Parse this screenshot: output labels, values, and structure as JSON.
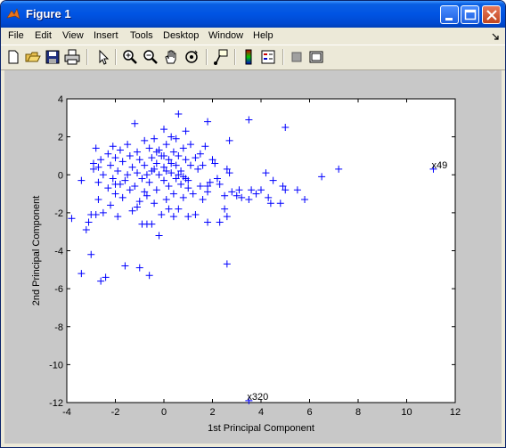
{
  "window": {
    "title": "Figure 1"
  },
  "menu": [
    "File",
    "Edit",
    "View",
    "Insert",
    "Tools",
    "Desktop",
    "Window",
    "Help"
  ],
  "toolbar_icons": [
    "new-icon",
    "open-icon",
    "save-icon",
    "print-icon",
    "pointer-icon",
    "zoom-in-icon",
    "zoom-out-icon",
    "pan-icon",
    "rotate-icon",
    "data-cursor-icon",
    "colorbar-icon",
    "legend-icon",
    "hide-tools-icon",
    "show-tools-icon"
  ],
  "colors": {
    "marker": "#0000ff",
    "figure_bg": "#c8c8c8",
    "titlebar": "#0054e3"
  },
  "chart_data": {
    "type": "scatter",
    "title": "",
    "xlabel": "1st Principal Component",
    "ylabel": "2nd Principal Component",
    "xlim": [
      -4,
      12
    ],
    "ylim": [
      -12,
      4
    ],
    "xticks": [
      -4,
      -2,
      0,
      2,
      4,
      6,
      8,
      10,
      12
    ],
    "yticks": [
      -12,
      -10,
      -8,
      -6,
      -4,
      -2,
      0,
      2,
      4
    ],
    "grid": false,
    "marker": "+",
    "annotations": [
      {
        "text": "x49",
        "x": 11.1,
        "y": 0.3
      },
      {
        "text": "x320",
        "x": 3.5,
        "y": -11.9
      }
    ],
    "points": [
      [
        11.1,
        0.3
      ],
      [
        3.5,
        -11.9
      ],
      [
        7.2,
        0.3
      ],
      [
        6.5,
        -0.1
      ],
      [
        5.8,
        -1.3
      ],
      [
        5.5,
        -0.8
      ],
      [
        5.0,
        -0.8
      ],
      [
        5.0,
        2.5
      ],
      [
        4.9,
        -0.6
      ],
      [
        4.8,
        -1.5
      ],
      [
        4.5,
        -0.3
      ],
      [
        4.4,
        -1.5
      ],
      [
        4.3,
        -1.2
      ],
      [
        4.2,
        0.1
      ],
      [
        4.0,
        -0.8
      ],
      [
        3.8,
        -1.0
      ],
      [
        3.6,
        -0.8
      ],
      [
        3.5,
        -1.3
      ],
      [
        3.5,
        2.9
      ],
      [
        3.2,
        -1.2
      ],
      [
        3.0,
        -1.1
      ],
      [
        2.8,
        -0.9
      ],
      [
        3.1,
        -0.8
      ],
      [
        2.6,
        0.3
      ],
      [
        2.7,
        0.1
      ],
      [
        2.6,
        -4.7
      ],
      [
        2.3,
        -2.5
      ],
      [
        2.6,
        -2.2
      ],
      [
        2.5,
        -1.1
      ],
      [
        2.5,
        -1.8
      ],
      [
        2.7,
        1.8
      ],
      [
        2.3,
        -0.5
      ],
      [
        2.0,
        0.8
      ],
      [
        2.1,
        0.6
      ],
      [
        2.2,
        -0.2
      ],
      [
        1.9,
        -0.4
      ],
      [
        1.8,
        -0.6
      ],
      [
        1.8,
        2.8
      ],
      [
        1.8,
        -2.5
      ],
      [
        1.8,
        -0.9
      ],
      [
        1.6,
        -1.3
      ],
      [
        1.7,
        1.5
      ],
      [
        1.6,
        0.5
      ],
      [
        1.5,
        1.1
      ],
      [
        1.5,
        -0.6
      ],
      [
        1.4,
        0.3
      ],
      [
        1.2,
        -1.0
      ],
      [
        1.3,
        -2.1
      ],
      [
        1.3,
        0.9
      ],
      [
        1.1,
        0.5
      ],
      [
        1.1,
        1.6
      ],
      [
        1.0,
        -0.3
      ],
      [
        1.0,
        -0.7
      ],
      [
        0.9,
        0.8
      ],
      [
        0.9,
        2.3
      ],
      [
        0.8,
        -1.2
      ],
      [
        0.8,
        1.4
      ],
      [
        0.7,
        0.2
      ],
      [
        0.7,
        -0.5
      ],
      [
        0.6,
        3.2
      ],
      [
        0.6,
        1.0
      ],
      [
        0.6,
        -1.8
      ],
      [
        0.5,
        0.5
      ],
      [
        0.5,
        -0.2
      ],
      [
        0.4,
        1.2
      ],
      [
        0.4,
        -1.0
      ],
      [
        0.3,
        2.0
      ],
      [
        0.3,
        0.1
      ],
      [
        0.2,
        -0.6
      ],
      [
        0.2,
        0.8
      ],
      [
        0.1,
        1.6
      ],
      [
        0.1,
        -1.3
      ],
      [
        0.0,
        0.4
      ],
      [
        0.0,
        2.4
      ],
      [
        0.0,
        -0.3
      ],
      [
        -0.1,
        1.0
      ],
      [
        -0.1,
        -2.1
      ],
      [
        -0.2,
        0.0
      ],
      [
        -0.2,
        1.3
      ],
      [
        -0.3,
        -0.8
      ],
      [
        -0.3,
        0.6
      ],
      [
        -0.4,
        1.9
      ],
      [
        -0.4,
        -1.5
      ],
      [
        -0.5,
        0.2
      ],
      [
        -0.5,
        0.9
      ],
      [
        -0.6,
        -0.4
      ],
      [
        -0.6,
        1.4
      ],
      [
        -0.7,
        0.0
      ],
      [
        -0.7,
        -1.1
      ],
      [
        -0.8,
        0.5
      ],
      [
        -0.8,
        1.8
      ],
      [
        -0.9,
        -0.2
      ],
      [
        -0.9,
        -2.6
      ],
      [
        -1.0,
        0.8
      ],
      [
        -1.0,
        -1.4
      ],
      [
        -1.1,
        0.1
      ],
      [
        -1.1,
        1.2
      ],
      [
        -1.2,
        -0.6
      ],
      [
        -1.2,
        2.7
      ],
      [
        -1.3,
        0.4
      ],
      [
        -1.3,
        -1.9
      ],
      [
        -1.4,
        1.0
      ],
      [
        -1.4,
        -0.8
      ],
      [
        -1.5,
        0.0
      ],
      [
        -1.5,
        1.6
      ],
      [
        -1.6,
        -0.3
      ],
      [
        -1.6,
        -4.8
      ],
      [
        -1.7,
        0.7
      ],
      [
        -1.7,
        -1.2
      ],
      [
        -1.8,
        1.3
      ],
      [
        -1.8,
        -0.5
      ],
      [
        -1.9,
        0.2
      ],
      [
        -1.9,
        -2.2
      ],
      [
        -2.0,
        0.9
      ],
      [
        -2.0,
        -1.0
      ],
      [
        -2.1,
        -0.2
      ],
      [
        -2.1,
        1.5
      ],
      [
        -2.2,
        0.5
      ],
      [
        -2.2,
        -1.6
      ],
      [
        -2.3,
        -0.7
      ],
      [
        -2.3,
        1.1
      ],
      [
        -2.4,
        -5.4
      ],
      [
        -2.5,
        0.0
      ],
      [
        -2.5,
        -2.0
      ],
      [
        -2.6,
        -5.6
      ],
      [
        -2.6,
        0.8
      ],
      [
        -2.7,
        -0.4
      ],
      [
        -2.7,
        -1.3
      ],
      [
        -2.8,
        1.4
      ],
      [
        -2.9,
        0.3
      ],
      [
        -3.0,
        -2.1
      ],
      [
        -3.0,
        -4.2
      ],
      [
        -3.1,
        -2.5
      ],
      [
        -3.2,
        -2.9
      ],
      [
        -3.4,
        -0.3
      ],
      [
        -3.4,
        -5.2
      ],
      [
        -2.8,
        -2.1
      ],
      [
        -2.7,
        0.4
      ],
      [
        -3.8,
        -2.3
      ],
      [
        -2.9,
        0.6
      ],
      [
        -2.0,
        -0.5
      ],
      [
        -1.0,
        -4.9
      ],
      [
        -0.6,
        -5.3
      ],
      [
        -0.5,
        -2.6
      ],
      [
        -0.7,
        -2.6
      ],
      [
        -0.2,
        -3.2
      ],
      [
        0.4,
        -2.2
      ],
      [
        1.0,
        -2.2
      ],
      [
        0.2,
        -1.8
      ],
      [
        -0.4,
        0.3
      ],
      [
        0.6,
        0.0
      ],
      [
        0.8,
        -0.1
      ],
      [
        0.0,
        1.0
      ],
      [
        -0.3,
        1.2
      ],
      [
        0.3,
        0.6
      ],
      [
        0.9,
        -0.2
      ],
      [
        -0.8,
        -0.9
      ],
      [
        -1.1,
        -1.7
      ],
      [
        0.5,
        1.9
      ],
      [
        0.1,
        0.2
      ]
    ]
  }
}
